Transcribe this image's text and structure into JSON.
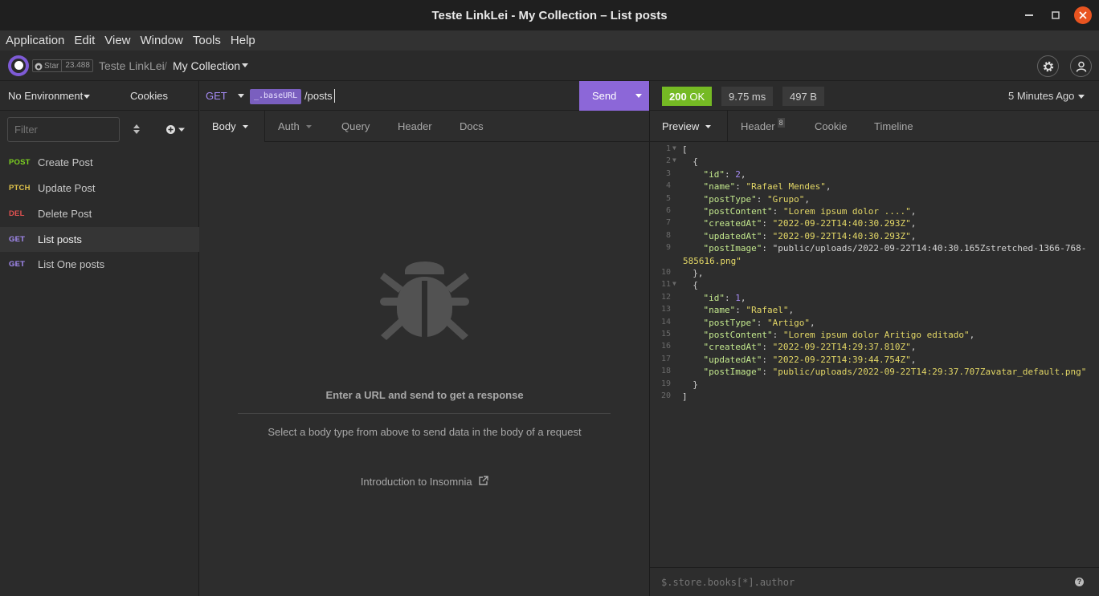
{
  "window": {
    "title": "Teste LinkLei - My Collection – List posts"
  },
  "menu": [
    "Application",
    "Edit",
    "View",
    "Window",
    "Tools",
    "Help"
  ],
  "header": {
    "star_label": "Star",
    "star_count": "23.488",
    "workspace": "Teste LinkLei",
    "separator": "/",
    "collection": "My Collection"
  },
  "sidebar": {
    "environment": "No Environment",
    "cookies": "Cookies",
    "filter_placeholder": "Filter",
    "requests": [
      {
        "method": "POST",
        "method_color": "#7ed321",
        "name": "Create Post"
      },
      {
        "method": "PTCH",
        "method_color": "#e0c34a",
        "name": "Update Post"
      },
      {
        "method": "DEL",
        "method_color": "#e15251",
        "name": "Delete Post"
      },
      {
        "method": "GET",
        "method_color": "#a58bf4",
        "name": "List posts",
        "active": true
      },
      {
        "method": "GET",
        "method_color": "#a58bf4",
        "name": "List One posts"
      }
    ]
  },
  "request": {
    "method": "GET",
    "url_tag": "_.baseURL",
    "url_path": "/posts",
    "send_label": "Send",
    "tabs": [
      "Body",
      "Auth",
      "Query",
      "Header",
      "Docs"
    ],
    "empty_title": "Enter a URL and send to get a response",
    "empty_hint": "Select a body type from above to send data in the body of a request",
    "intro_link": "Introduction to Insomnia"
  },
  "response": {
    "status": "200 OK",
    "status_code": "200",
    "status_text": "OK",
    "time": "9.75 ms",
    "size": "497 B",
    "age": "5 Minutes Ago",
    "tabs": [
      "Preview",
      "Header",
      "Cookie",
      "Timeline"
    ],
    "header_count": "8",
    "filter_placeholder": "$.store.books[*].author",
    "help": "?",
    "lines": [
      "[",
      "  {",
      "    \"id\": 2,",
      "    \"name\": \"Rafael Mendes\",",
      "    \"postType\": \"Grupo\",",
      "    \"postContent\": \"Lorem ipsum dolor ....\",",
      "    \"createdAt\": \"2022-09-22T14:40:30.293Z\",",
      "    \"updatedAt\": \"2022-09-22T14:40:30.293Z\",",
      "    \"postImage\": \"public/uploads/2022-09-22T14:40:30.165Zstretched-1366-768-",
      "585616.png\"",
      "  },",
      "  {",
      "    \"id\": 1,",
      "    \"name\": \"Rafael\",",
      "    \"postType\": \"Artigo\",",
      "    \"postContent\": \"Lorem ipsum dolor Aritigo editado\",",
      "    \"createdAt\": \"2022-09-22T14:29:37.810Z\",",
      "    \"updatedAt\": \"2022-09-22T14:39:44.754Z\",",
      "    \"postImage\": \"public/uploads/2022-09-22T14:29:37.707Zavatar_default.png\"",
      "  }",
      "]"
    ],
    "line_numbers": [
      "1",
      "2",
      "3",
      "4",
      "5",
      "6",
      "7",
      "8",
      "9",
      "",
      "10",
      "11",
      "12",
      "13",
      "14",
      "15",
      "16",
      "17",
      "18",
      "19",
      "20"
    ]
  },
  "colors": {
    "accent": "#7e5bd6",
    "ok": "#75ba24",
    "send": "#8c67d8"
  }
}
